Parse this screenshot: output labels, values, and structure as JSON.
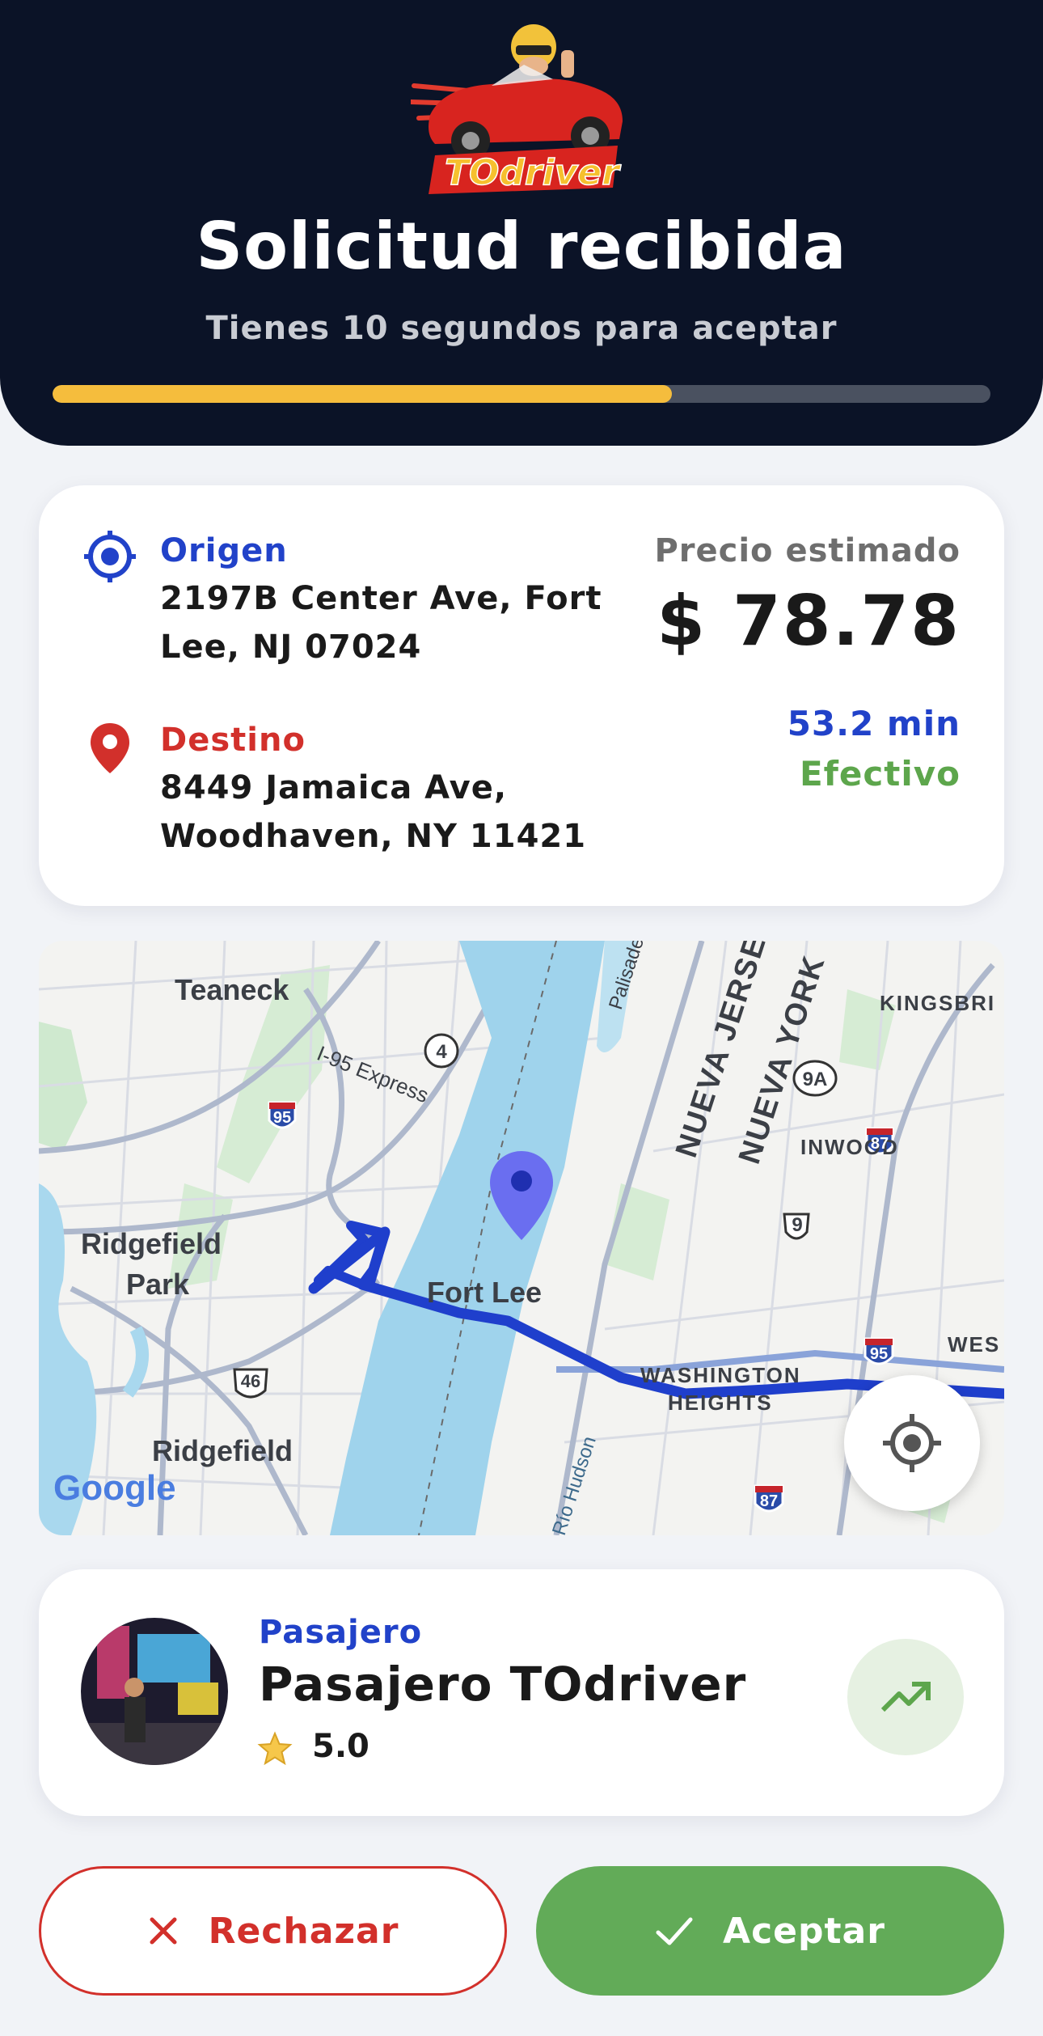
{
  "header": {
    "logo_text": "TOdriver",
    "title": "Solicitud recibida",
    "subtitle": "Tienes 10 segundos para aceptar",
    "progress_fraction": 0.66
  },
  "trip": {
    "origin_label": "Origen",
    "origin_address_line1": "2197B Center Ave, Fort",
    "origin_address_line2": "Lee, NJ 07024",
    "destination_label": "Destino",
    "destination_address_line1": "8449 Jamaica Ave,",
    "destination_address_line2": "Woodhaven, NY 11421",
    "price_label": "Precio estimado",
    "price_value": "$ 78.78",
    "duration": "53.2 min",
    "payment_method": "Efectivo"
  },
  "map": {
    "labels": {
      "teaneck": "Teaneck",
      "kingsbridge": "KINGSBRI",
      "i95_express": "I-95 Express",
      "palisades": "Palisades Inte",
      "nueva_jersey": "NUEVA JERSE",
      "nueva_york": "NUEVA YORK",
      "inwood": "INWOOD",
      "ridgefield_park_1": "Ridgefield",
      "ridgefield_park_2": "Park",
      "fort_lee": "Fort Lee",
      "washington_heights_1": "WASHINGTON",
      "washington_heights_2": "HEIGHTS",
      "west": "WES",
      "ridgefield": "Ridgefield",
      "rio_hudson": "Río Hudson",
      "google": "Google"
    },
    "shields": {
      "r4": "4",
      "r9a": "9A",
      "r9": "9",
      "i95_a": "95",
      "i95_b": "95",
      "i87_a": "87",
      "i87_b": "87",
      "us46": "46"
    }
  },
  "passenger": {
    "label": "Pasajero",
    "name": "Pasajero TOdriver",
    "rating": "5.0"
  },
  "actions": {
    "reject_label": "Rechazar",
    "accept_label": "Aceptar"
  },
  "colors": {
    "header_bg": "#0b1327",
    "progress": "#f5bd3d",
    "blue": "#2142c9",
    "red": "#d2302b",
    "green": "#62ab58",
    "route": "#1f3fcc",
    "water": "#9fd3ec"
  }
}
